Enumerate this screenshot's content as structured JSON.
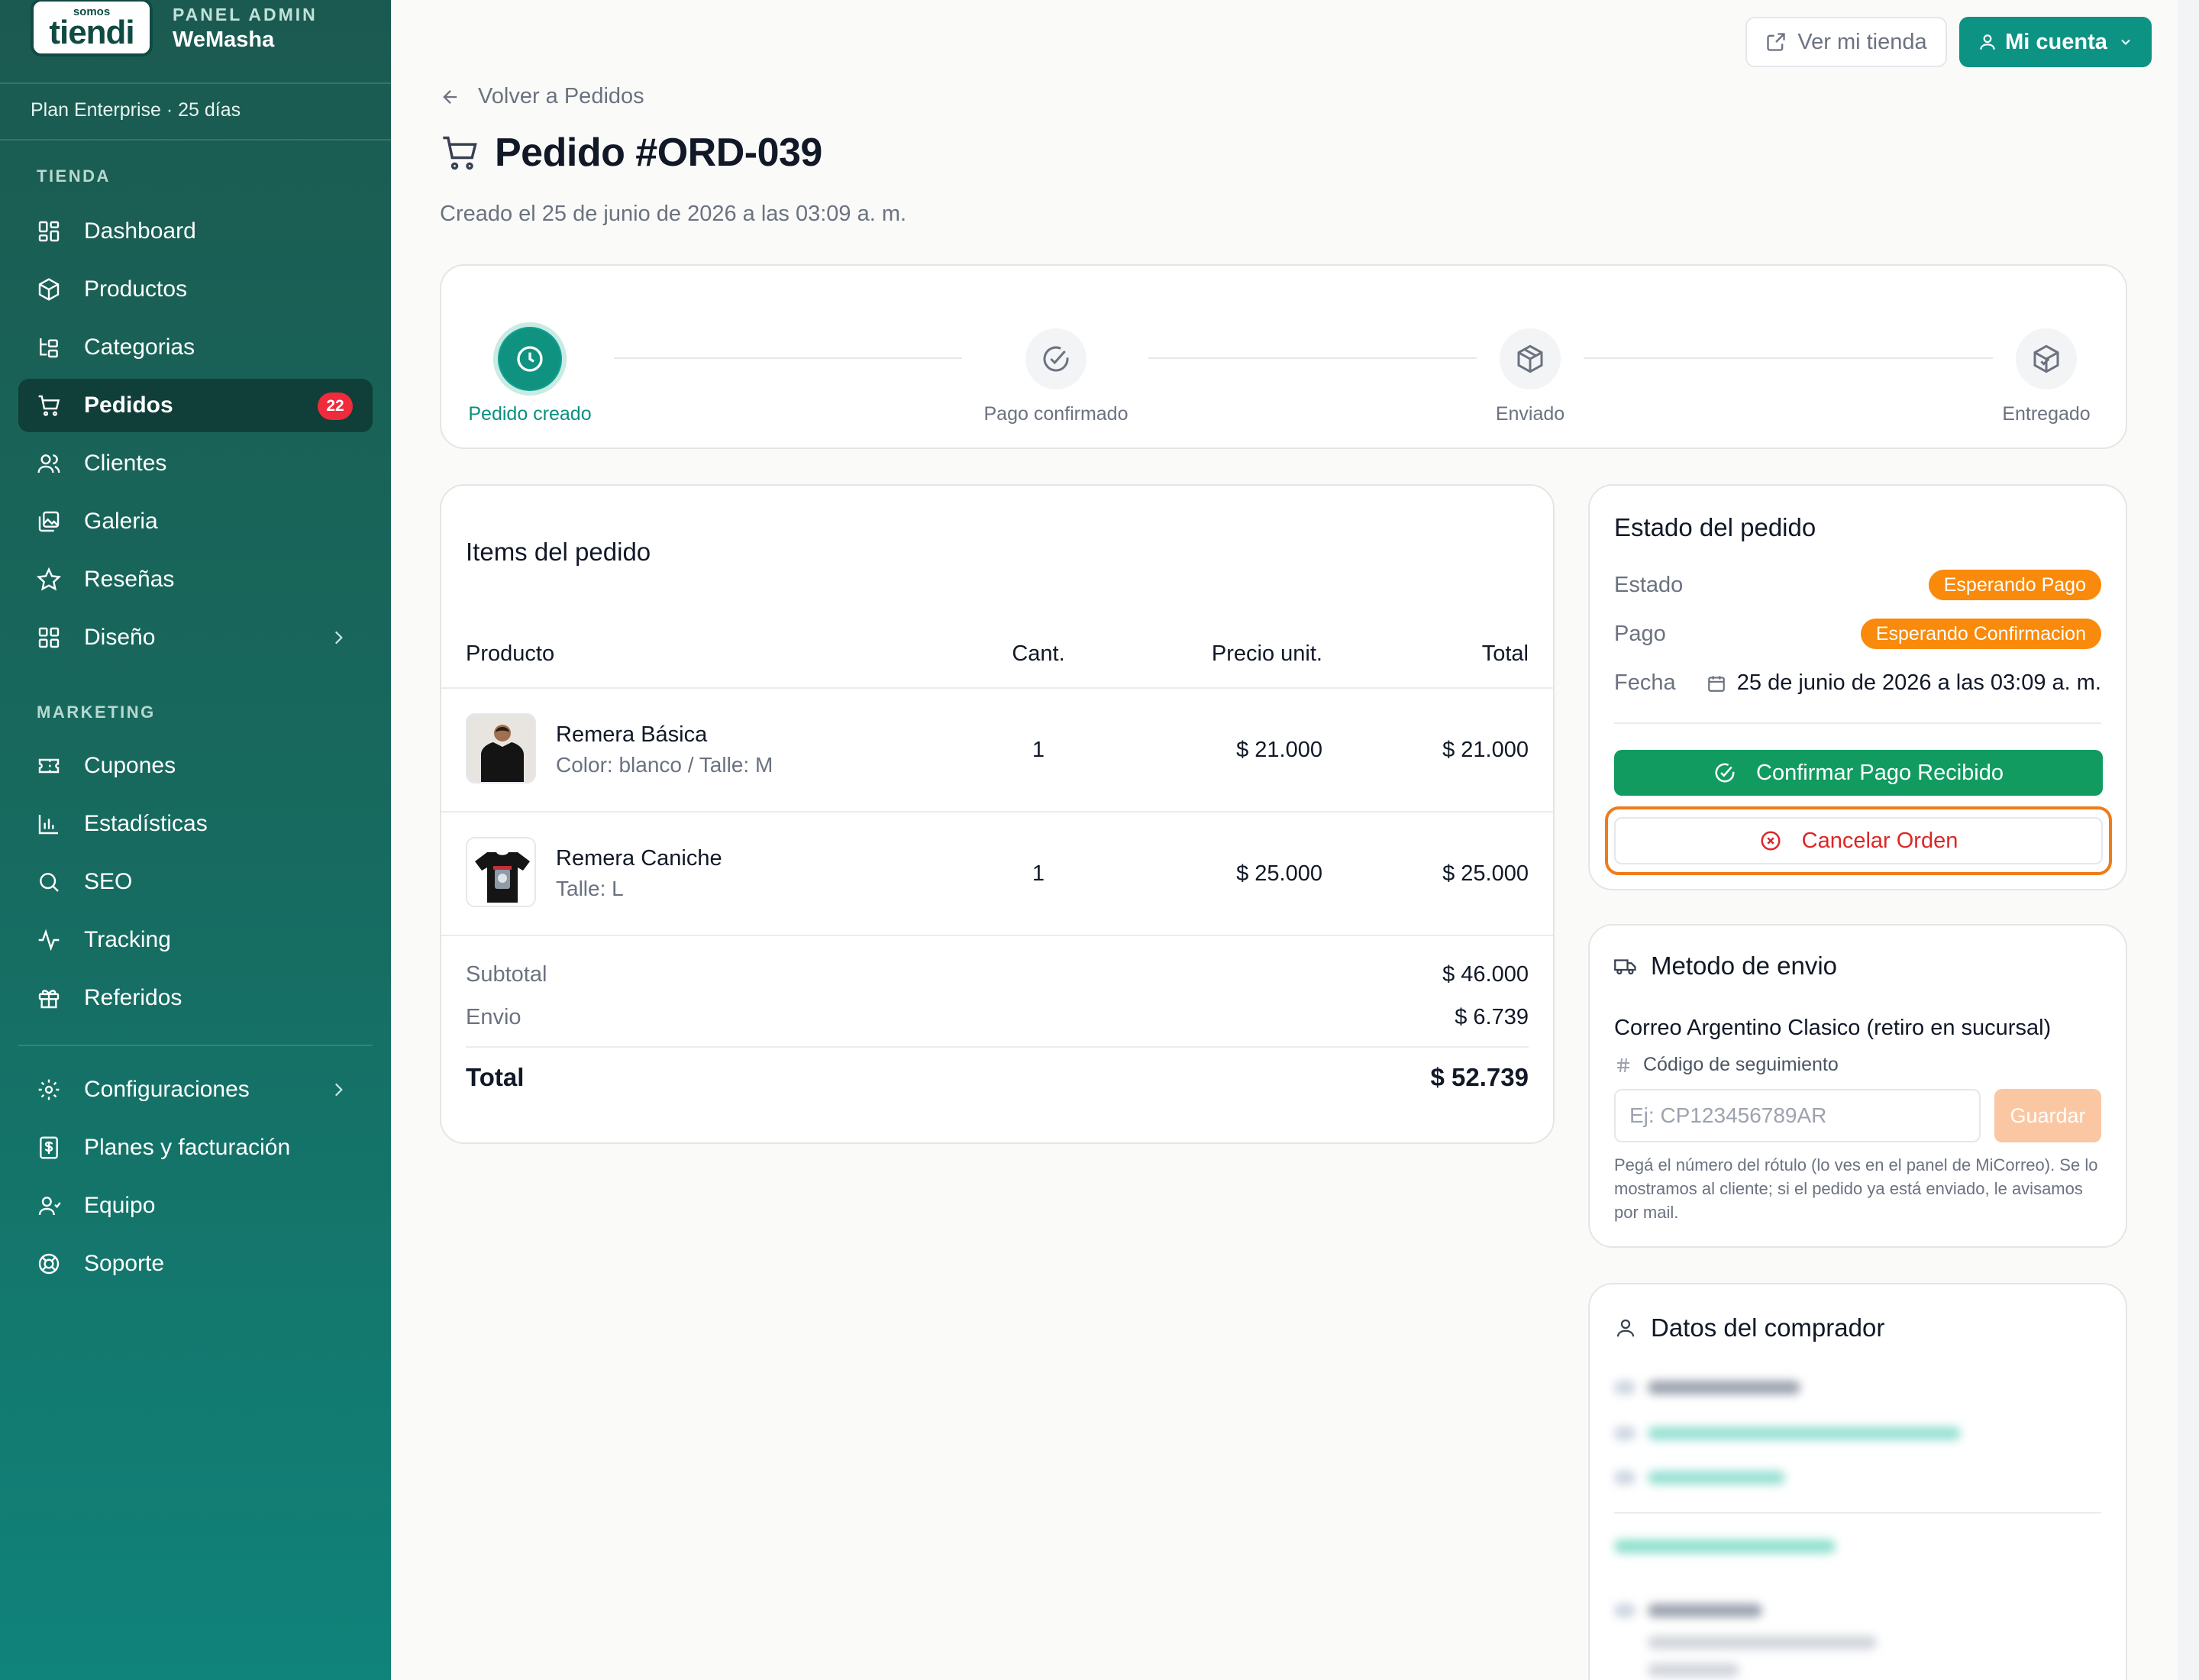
{
  "brand": {
    "logo_small": "somos",
    "logo_big": "tiendi",
    "panel_label": "PANEL ADMIN",
    "store_name": "WeMasha"
  },
  "plan": "Plan Enterprise · 25 días",
  "sidebar": {
    "section_store": "TIENDA",
    "section_marketing": "MARKETING",
    "store_items": [
      {
        "label": "Dashboard",
        "icon": "dashboard-icon"
      },
      {
        "label": "Productos",
        "icon": "box-icon"
      },
      {
        "label": "Categorias",
        "icon": "categories-icon"
      },
      {
        "label": "Pedidos",
        "icon": "cart-icon",
        "badge": "22",
        "active": true
      },
      {
        "label": "Clientes",
        "icon": "users-icon"
      },
      {
        "label": "Galeria",
        "icon": "gallery-icon"
      },
      {
        "label": "Reseñas",
        "icon": "star-icon"
      },
      {
        "label": "Diseño",
        "icon": "layout-icon"
      }
    ],
    "marketing_items": [
      {
        "label": "Cupones",
        "icon": "ticket-icon"
      },
      {
        "label": "Estadísticas",
        "icon": "bar-chart-icon"
      },
      {
        "label": "SEO",
        "icon": "search-icon"
      },
      {
        "label": "Tracking",
        "icon": "activity-icon"
      },
      {
        "label": "Referidos",
        "icon": "gift-icon"
      }
    ],
    "bottom_items": [
      {
        "label": "Configuraciones",
        "icon": "gear-icon"
      },
      {
        "label": "Planes y facturación",
        "icon": "receipt-icon"
      },
      {
        "label": "Equipo",
        "icon": "user-icon"
      },
      {
        "label": "Soporte",
        "icon": "lifebuoy-icon"
      }
    ]
  },
  "topbar": {
    "view_store": "Ver mi tienda",
    "account": "Mi cuenta"
  },
  "header": {
    "back": "Volver a Pedidos",
    "title": "Pedido #ORD-039",
    "created": "Creado el 25 de junio de 2026 a las 03:09 a. m."
  },
  "stepper": [
    {
      "label": "Pedido creado",
      "icon": "clock-icon",
      "done": true
    },
    {
      "label": "Pago confirmado",
      "icon": "check-circle-icon",
      "done": false
    },
    {
      "label": "Enviado",
      "icon": "package-icon",
      "done": false
    },
    {
      "label": "Entregado",
      "icon": "package-check-icon",
      "done": false
    }
  ],
  "items": {
    "title": "Items del pedido",
    "columns": {
      "product": "Producto",
      "qty": "Cant.",
      "unit_price": "Precio unit.",
      "total": "Total"
    },
    "rows": [
      {
        "name": "Remera Básica",
        "variant": "Color: blanco / Talle: M",
        "qty": "1",
        "unit_price": "$ 21.000",
        "total": "$ 21.000"
      },
      {
        "name": "Remera Caniche",
        "variant": "Talle: L",
        "qty": "1",
        "unit_price": "$ 25.000",
        "total": "$ 25.000"
      }
    ],
    "subtotal_label": "Subtotal",
    "subtotal": "$ 46.000",
    "shipping_label": "Envio",
    "shipping": "$ 6.739",
    "total_label": "Total",
    "total": "$ 52.739"
  },
  "status": {
    "title": "Estado del pedido",
    "state_label": "Estado",
    "state": "Esperando Pago",
    "payment_label": "Pago",
    "payment": "Esperando Confirmacion",
    "date_label": "Fecha",
    "date": "25 de junio de 2026 a las 03:09 a. m.",
    "confirm_button": "Confirmar Pago Recibido",
    "cancel_button": "Cancelar Orden",
    "badge_color": "#f98a0b"
  },
  "shipping": {
    "title": "Metodo de envio",
    "method": "Correo Argentino Clasico (retiro en sucursal)",
    "tracking_label": "Código de seguimiento",
    "tracking_placeholder": "Ej: CP123456789AR",
    "save_button": "Guardar",
    "hint": "Pegá el número del rótulo (lo ves en el panel de MiCorreo). Se lo mostramos al cliente; si el pedido ya está enviado, le avisamos por mail."
  },
  "buyer": {
    "title": "Datos del comprador"
  },
  "colors": {
    "brand_green": "#0d9384",
    "sidebar_dark": "#1b5a50",
    "danger": "#dc2626",
    "confirm_green": "#119b60"
  }
}
